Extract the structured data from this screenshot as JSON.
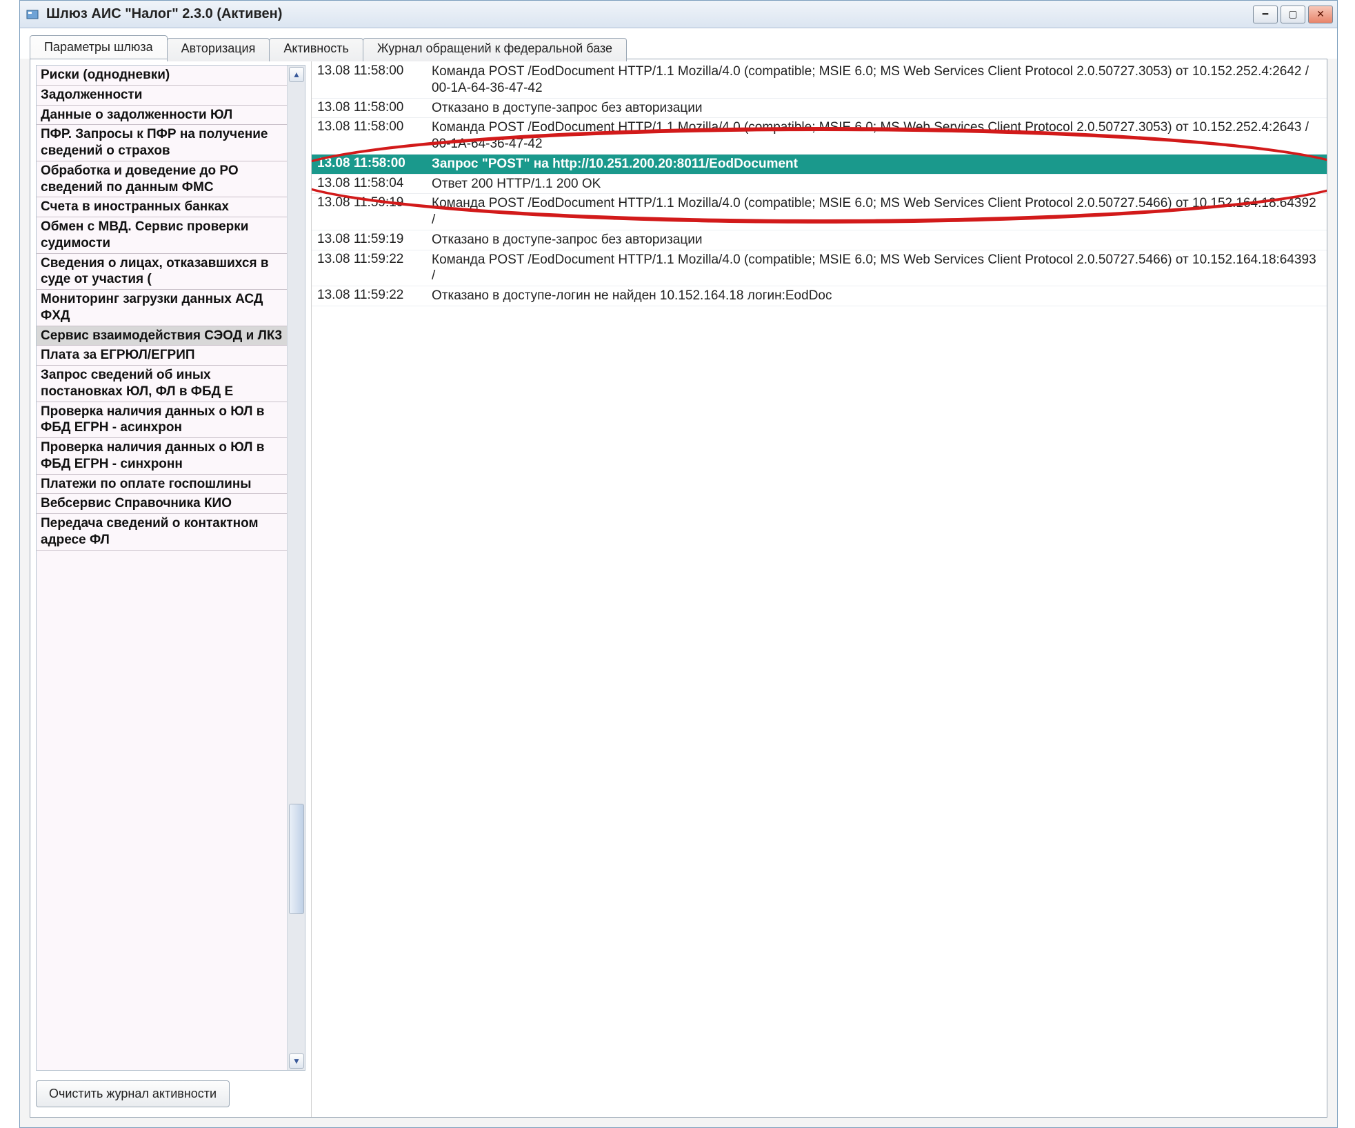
{
  "window": {
    "title": "Шлюз АИС \"Налог\" 2.3.0 (Активен)"
  },
  "tabs": {
    "items": [
      {
        "label": "Параметры шлюза",
        "active": true
      },
      {
        "label": "Авторизация",
        "active": false
      },
      {
        "label": "Активность",
        "active": false
      },
      {
        "label": "Журнал обращений к федеральной базе",
        "active": false
      }
    ]
  },
  "sidebar": {
    "items": [
      {
        "label": "Риски (однодневки)"
      },
      {
        "label": "Задолженности"
      },
      {
        "label": "Данные о задолженности ЮЛ"
      },
      {
        "label": "ПФР. Запросы к ПФР на получение сведений о страхов"
      },
      {
        "label": "Обработка и доведение до РО сведений по данным ФМС"
      },
      {
        "label": "Счета в иностранных банках"
      },
      {
        "label": "Обмен с МВД. Сервис проверки судимости"
      },
      {
        "label": "Сведения о лицах, отказавшихся в суде от участия ("
      },
      {
        "label": "Мониторинг загрузки данных АСД ФХД"
      },
      {
        "label": "Сервис взаимодействия СЭОД и ЛК3",
        "selected": true
      },
      {
        "label": "Плата за ЕГРЮЛ/ЕГРИП"
      },
      {
        "label": "Запрос сведений об иных постановках ЮЛ, ФЛ в ФБД Е"
      },
      {
        "label": "Проверка наличия данных о ЮЛ в ФБД ЕГРН - асинхрон"
      },
      {
        "label": "Проверка наличия данных о ЮЛ в ФБД ЕГРН - синхронн"
      },
      {
        "label": "Платежи по оплате госпошлины"
      },
      {
        "label": "Вебсервис Справочника КИО"
      },
      {
        "label": "Передача сведений о контактном адресе ФЛ"
      }
    ],
    "clear_button": "Очистить журнал активности"
  },
  "log": {
    "rows": [
      {
        "time": "13.08 11:58:00",
        "msg": "Команда POST /EodDocument HTTP/1.1 Mozilla/4.0 (compatible; MSIE 6.0; MS Web Services Client Protocol 2.0.50727.3053) от 10.152.252.4:2642 / 00-1A-64-36-47-42"
      },
      {
        "time": "13.08 11:58:00",
        "msg": "Отказано в доступе-запрос без авторизации"
      },
      {
        "time": "13.08 11:58:00",
        "msg": "Команда POST /EodDocument HTTP/1.1 Mozilla/4.0 (compatible; MSIE 6.0; MS Web Services Client Protocol 2.0.50727.3053) от 10.152.252.4:2643 / 00-1A-64-36-47-42"
      },
      {
        "time": "13.08 11:58:00",
        "msg": "Запрос \"POST\" на http://10.251.200.20:8011/EodDocument",
        "selected": true
      },
      {
        "time": "13.08 11:58:04",
        "msg": "Ответ 200 HTTP/1.1 200 OK"
      },
      {
        "time": "13.08 11:59:19",
        "msg": "Команда POST /EodDocument HTTP/1.1 Mozilla/4.0 (compatible; MSIE 6.0; MS Web Services Client Protocol 2.0.50727.5466) от 10.152.164.18:64392 /"
      },
      {
        "time": "13.08 11:59:19",
        "msg": "Отказано в доступе-запрос без авторизации"
      },
      {
        "time": "13.08 11:59:22",
        "msg": "Команда POST /EodDocument HTTP/1.1 Mozilla/4.0 (compatible; MSIE 6.0; MS Web Services Client Protocol 2.0.50727.5466) от 10.152.164.18:64393 /"
      },
      {
        "time": "13.08 11:59:22",
        "msg": "Отказано в доступе-логин не найден 10.152.164.18 логин:EodDoc"
      }
    ]
  },
  "annotation": {
    "ellipse_color": "#d21a1a"
  }
}
